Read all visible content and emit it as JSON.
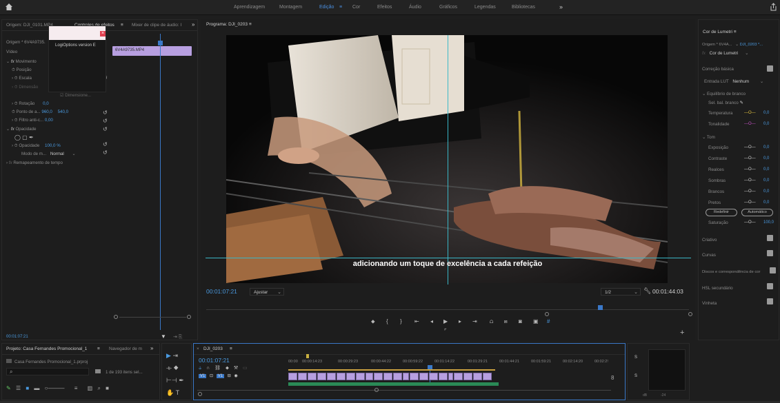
{
  "workspaces": {
    "items": [
      "Aprendizagem",
      "Montagem",
      "Edição",
      "Cor",
      "Efeitos",
      "Áudio",
      "Gráficos",
      "Legendas",
      "Bibliotecas"
    ],
    "active": "Edição",
    "more": "»"
  },
  "source_panel": {
    "tabs": [
      "Origem: DJI_0101.MP4",
      "Controles de efeitos",
      "Mixer de clipe de áudio: I"
    ],
    "more": "»",
    "source_label": "Origem * 6V4A9735.",
    "video_label": "Vídeo",
    "clip_name": "6V4A9735.MP4",
    "props": {
      "movimento": "Movimento",
      "posicao": "Posição",
      "escala": "Escala",
      "dimensao": "Dimensão",
      "dimension_check": "Dimensione...",
      "rotacao": "Rotação",
      "rotacao_val": "0,0",
      "ponto": "Ponto de a...",
      "ponto_x": "960,0",
      "ponto_y": "540,0",
      "filtro": "Filtro anti-c...",
      "filtro_val": "0,00",
      "opacidade": "Opacidade",
      "opacidade_label": "Opacidade",
      "opacidade_val": "100,0 %",
      "modo": "Modo de m...",
      "modo_val": "Normal",
      "remap": "Remapeamento de tempo"
    },
    "timecode": "00:01:07:21"
  },
  "popup": {
    "title": "LogiOptions version E",
    "close": "×"
  },
  "program": {
    "title": "Programa: DJI_0203",
    "caption": "adicionando um toque de excelência a cada refeição",
    "timecode": "00:01:07:21",
    "fit": "Ajustar",
    "quality": "1/2",
    "duration": "00:01:44:03"
  },
  "lumetri": {
    "title": "Cor de Lumetri",
    "source_a": "Origem * 6V4A...",
    "source_b": "DJI_0203 *...",
    "effect": "Cor de Lumetri",
    "basic": "Correção básica",
    "lut_label": "Entrada LUT",
    "lut_val": "Nenhum",
    "wb": "Equilíbrio de branco",
    "wb_picker": "Sel. bal. branco",
    "temp": "Temperatura",
    "temp_val": "0,0",
    "tint": "Tonalidade",
    "tint_val": "0,0",
    "tom": "Tom",
    "tones": [
      {
        "label": "Exposição",
        "val": "0,0"
      },
      {
        "label": "Contraste",
        "val": "0,0"
      },
      {
        "label": "Realces",
        "val": "0,0"
      },
      {
        "label": "Sombras",
        "val": "0,0"
      },
      {
        "label": "Brancos",
        "val": "0,0"
      },
      {
        "label": "Pretos",
        "val": "0,0"
      }
    ],
    "reset": "Redefinir",
    "auto": "Automático",
    "sat": "Saturação",
    "sat_val": "100,0",
    "sections": [
      "Criativo",
      "Curvas",
      "Discos e correspondência de cor",
      "HSL secundário",
      "Vinheta"
    ]
  },
  "project": {
    "tabs": [
      "Projeto: Casa Fernandes Promocional_1",
      "Navegador de m"
    ],
    "more": "»",
    "file": "Casa Fernandes Promocional_1.prproj",
    "count": "1 de 193 itens sel..."
  },
  "timeline": {
    "tab": "DJI_0203",
    "timecode": "00:01:07:21",
    "ruler": [
      "00:00",
      "00:00:14:23",
      "00:00:29:23",
      "00:00:44:22",
      "00:00:59:22",
      "00:01:14:22",
      "00:01:29:21",
      "00:01:44:21",
      "00:01:59:21",
      "00:02:14:20",
      "00:02:2!"
    ],
    "tracks": [
      "V1",
      "V1"
    ]
  },
  "meter": {
    "labels": [
      "S",
      "S"
    ],
    "scale": [
      "dB",
      "-24"
    ]
  }
}
